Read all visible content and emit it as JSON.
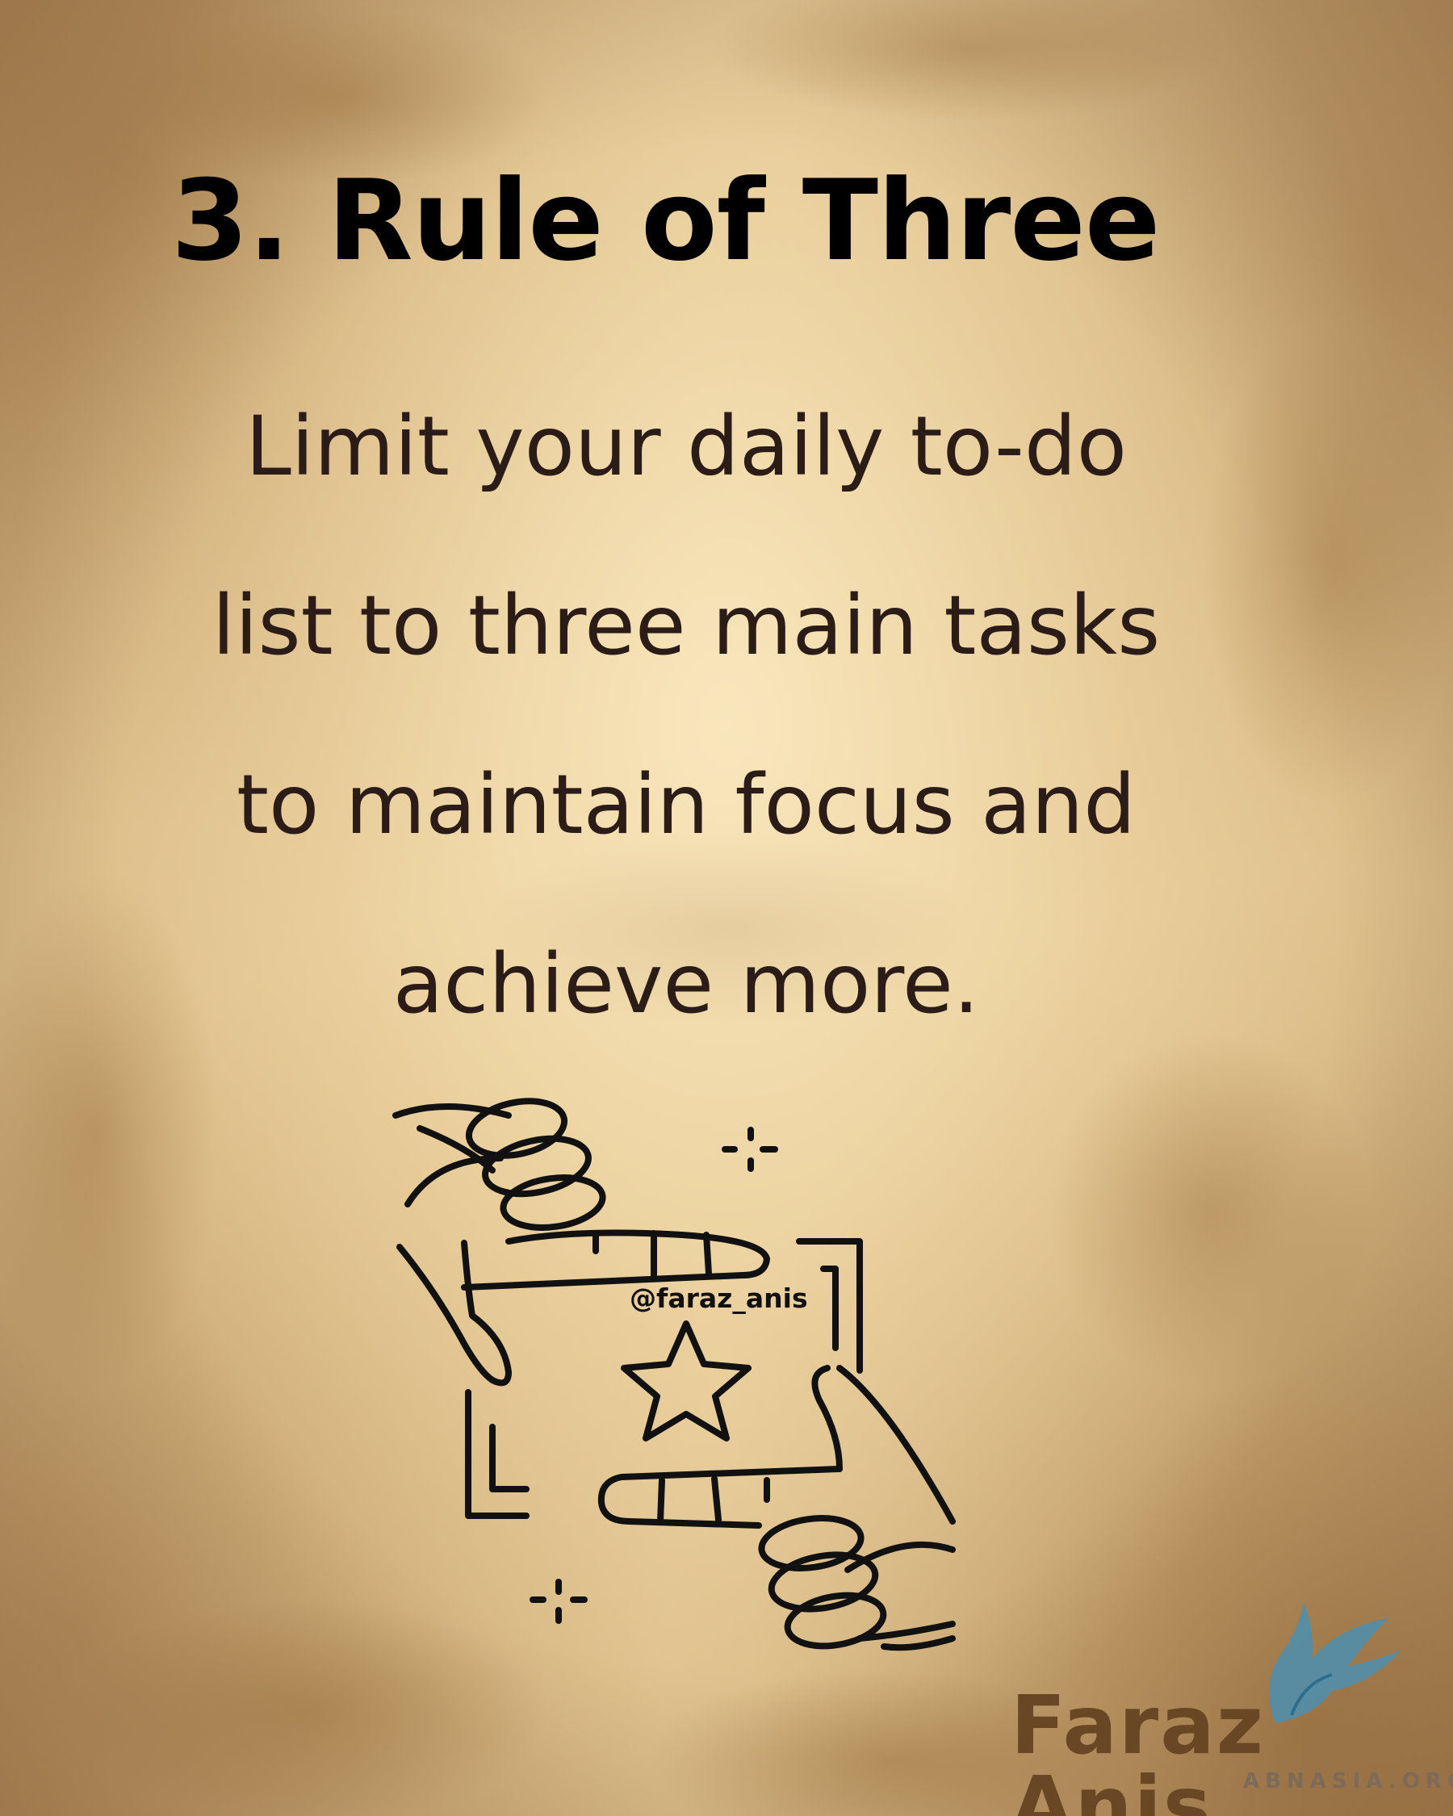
{
  "title": "3. Rule of Three",
  "body_lines": [
    "Limit your daily to-do",
    "list to three main tasks",
    "to maintain focus and",
    "achieve more."
  ],
  "handle": "@faraz_anis",
  "logo": {
    "name": "Faraz Anis",
    "site": "ABNASIA.ORG"
  },
  "icons": [
    "hands-frame-icon",
    "star-icon",
    "sparkle-icon",
    "bird-logo-icon"
  ],
  "colors": {
    "parchment": "#e2c592",
    "title": "#000000",
    "body_text": "#2c1c18",
    "logo_text": "#6a4724",
    "logo_bird": "#4c8fb0"
  }
}
